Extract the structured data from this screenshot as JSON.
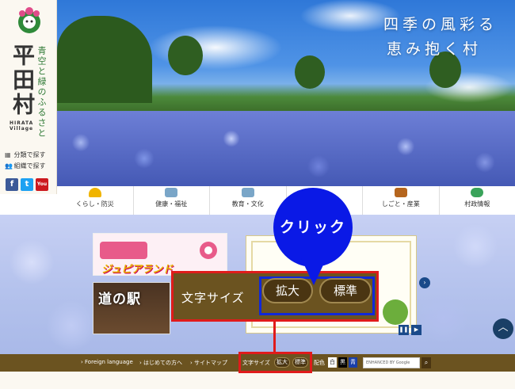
{
  "sidebar": {
    "village_name": "平田村",
    "slogan": "青空と緑のふるさと",
    "romaji_line1": "HIRATA",
    "romaji_line2": "Village",
    "nav": [
      {
        "label": "分類で探す",
        "icon": "grid-icon"
      },
      {
        "label": "組織で探す",
        "icon": "people-icon"
      }
    ],
    "social": [
      {
        "label": "f",
        "icon": "facebook-icon",
        "color": "#3b5998"
      },
      {
        "label": "t",
        "icon": "twitter-icon",
        "color": "#1da1f2"
      },
      {
        "label": "You",
        "icon": "youtube-icon",
        "color": "#cc181e"
      }
    ]
  },
  "hero": {
    "catch_line1": "四季の風彩る",
    "catch_line2": "恵み抱く村"
  },
  "categories": [
    {
      "label": "くらし・防災",
      "icon": "helmet-icon",
      "color": "#f0b400"
    },
    {
      "label": "健康・福祉",
      "icon": "medical-icon",
      "color": "#7aa6c8"
    },
    {
      "label": "教育・文化",
      "icon": "book-icon",
      "color": "#7aa6c8"
    },
    {
      "label": "",
      "icon": "hidden-icon",
      "color": "#cccccc"
    },
    {
      "label": "しごと・産業",
      "icon": "briefcase-icon",
      "color": "#b5651d"
    },
    {
      "label": "村政情報",
      "icon": "chat-icon",
      "color": "#3aa35a"
    }
  ],
  "banners": {
    "joypia": "ジュピアランド",
    "michinoeki": "道の駅"
  },
  "callout": {
    "text": "クリック"
  },
  "zoom": {
    "label": "文字サイズ",
    "enlarge": "拡大",
    "standard": "標準"
  },
  "footer": {
    "links": [
      "Foreign language",
      "はじめての方へ",
      "サイトマップ"
    ],
    "fontsize_label": "文字サイズ",
    "enlarge": "拡大",
    "standard": "標準",
    "color_label": "配色",
    "color_options": [
      "白",
      "黒",
      "青"
    ],
    "search_placeholder": "ENHANCED BY Google"
  },
  "colors": {
    "footer_bg": "#6b5320",
    "highlight_red": "#e01b1b",
    "callout_blue": "#0a19e6"
  }
}
